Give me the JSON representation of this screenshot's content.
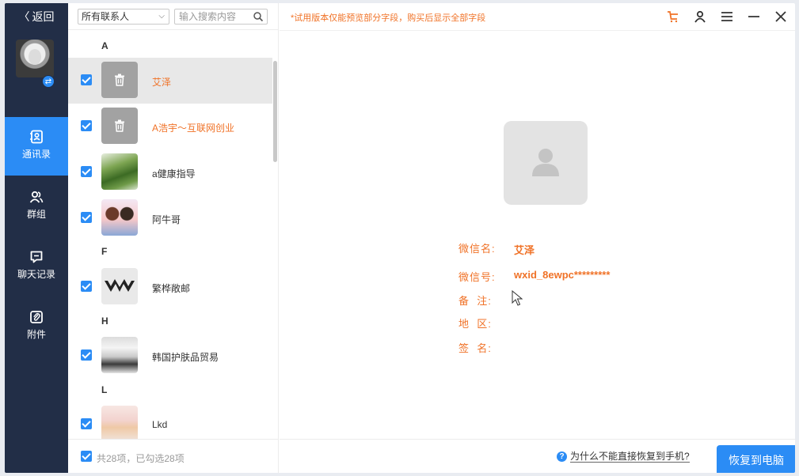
{
  "nav": {
    "back_label": "返回",
    "items": [
      {
        "label": "通讯录",
        "icon": "contacts-icon",
        "active": true
      },
      {
        "label": "群组",
        "icon": "group-icon",
        "active": false
      },
      {
        "label": "聊天记录",
        "icon": "chat-icon",
        "active": false
      },
      {
        "label": "附件",
        "icon": "attachment-icon",
        "active": false
      }
    ]
  },
  "list_panel": {
    "filter_value": "所有联系人",
    "search_placeholder": "输入搜索内容",
    "groups": [
      {
        "letter": "A",
        "contacts": [
          {
            "name": "艾泽",
            "deleted": true,
            "checked": true,
            "selected": true
          },
          {
            "name": "A浩宇～互联网创业",
            "deleted": true,
            "checked": true
          },
          {
            "name": "a健康指导",
            "deleted": false,
            "checked": true
          },
          {
            "name": "阿牛哥",
            "deleted": false,
            "checked": true
          }
        ]
      },
      {
        "letter": "F",
        "contacts": [
          {
            "name": "繁桦敞邮",
            "deleted": false,
            "checked": true
          }
        ]
      },
      {
        "letter": "H",
        "contacts": [
          {
            "name": "韩国护肤品贸易",
            "deleted": false,
            "checked": true
          }
        ]
      },
      {
        "letter": "L",
        "contacts": [
          {
            "name": "Lkd",
            "deleted": false,
            "checked": true
          }
        ]
      }
    ],
    "footer_count": "共28项，已勾选28项"
  },
  "main": {
    "trial_notice": "*试用版本仅能预览部分字段，购买后显示全部字段",
    "profile": {
      "wechat_name_label": "微信名:",
      "wechat_name_value": "艾泽",
      "wechat_id_label": "微信号:",
      "wechat_id_value": "wxid_8ewpc*********",
      "remark_label": "备  注:",
      "region_label": "地  区:",
      "signature_label": "签  名:"
    },
    "help_text": "为什么不能直接恢复到手机?",
    "help_icon": "?",
    "restore_button": "恢复到电脑"
  },
  "colors": {
    "nav_bg": "#222e47",
    "accent": "#2b8cf5",
    "warning": "#f07227"
  }
}
